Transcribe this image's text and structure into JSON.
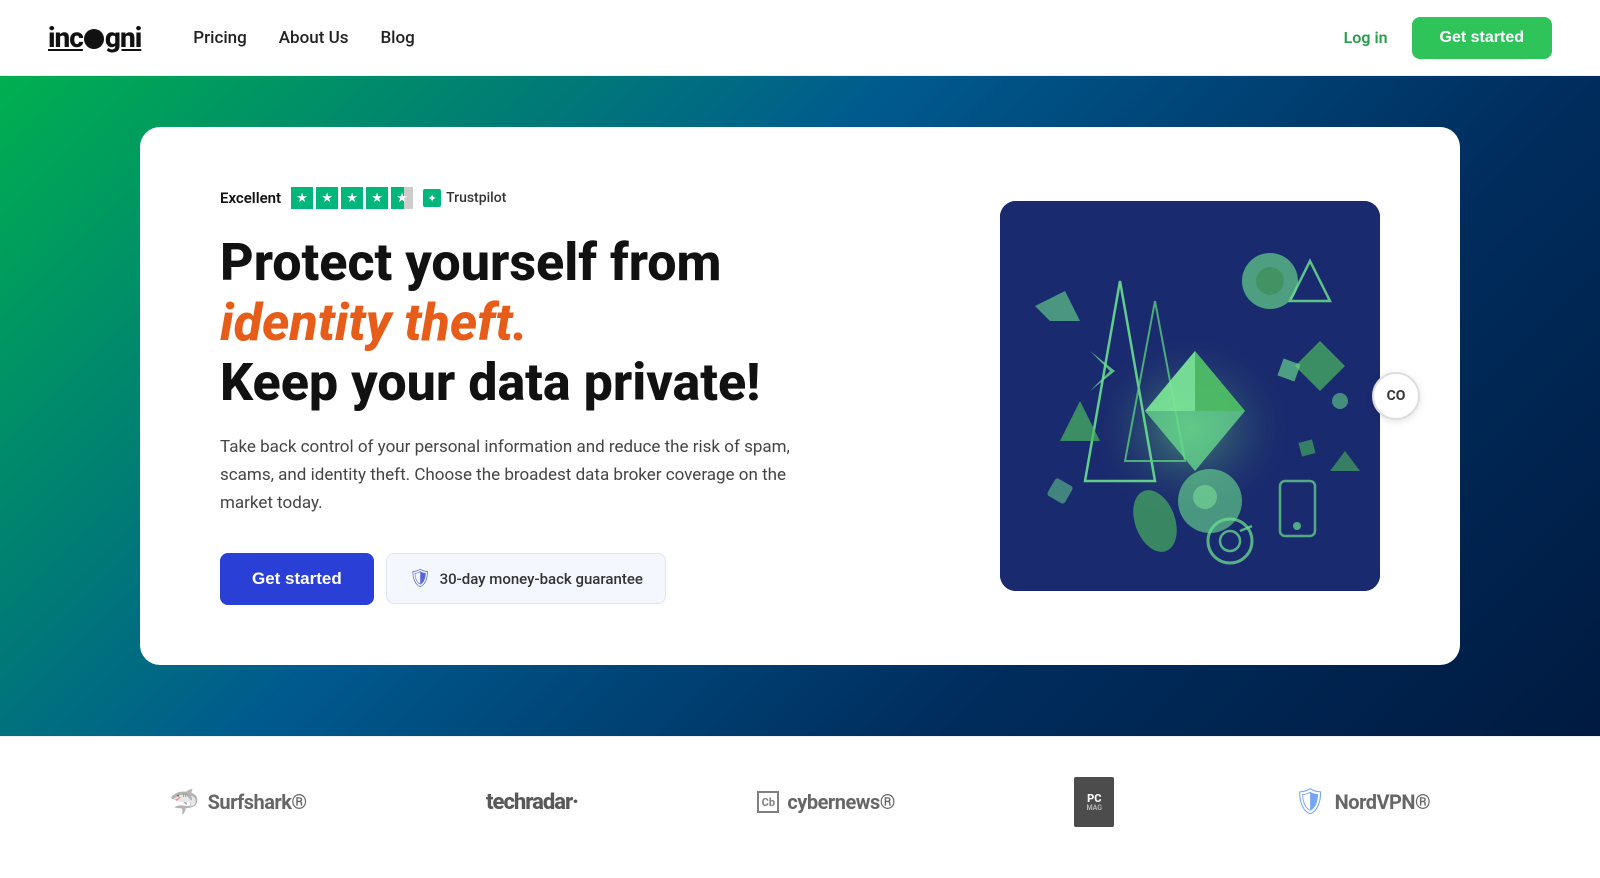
{
  "navbar": {
    "logo": "incogni",
    "nav_links": [
      {
        "label": "Pricing",
        "href": "#"
      },
      {
        "label": "About Us",
        "href": "#"
      },
      {
        "label": "Blog",
        "href": "#"
      }
    ],
    "login_label": "Log in",
    "get_started_label": "Get started"
  },
  "hero": {
    "trustpilot_excellent": "Excellent",
    "trustpilot_brand": "Trustpilot",
    "title_part1": "Protect yourself from ",
    "title_highlight": "identity theft.",
    "title_part2": "Keep your data private!",
    "description": "Take back control of your personal information and reduce the risk of spam, scams, and identity theft. Choose the broadest data broker coverage on the market today.",
    "cta_button": "Get started",
    "money_back": "30-day money-back guarantee"
  },
  "scroll_indicator": "CO",
  "brands": [
    {
      "name": "Surfshark®",
      "type": "surfshark"
    },
    {
      "name": "techradar·",
      "type": "techradar"
    },
    {
      "name": "cybernews®",
      "type": "cybernews"
    },
    {
      "name": "PC MAG",
      "type": "pcmag"
    },
    {
      "name": "NordVPN®",
      "type": "nordvpn"
    }
  ]
}
